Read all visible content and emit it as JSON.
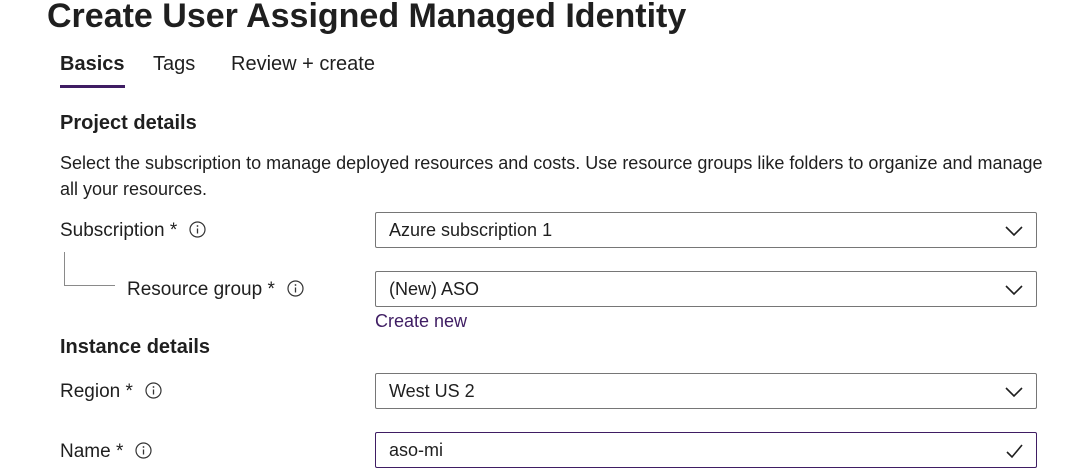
{
  "page": {
    "title": "Create User Assigned Managed Identity"
  },
  "tabs": [
    {
      "label": "Basics",
      "active": true
    },
    {
      "label": "Tags",
      "active": false
    },
    {
      "label": "Review + create",
      "active": false
    }
  ],
  "project_details": {
    "heading": "Project details",
    "description": "Select the subscription to manage deployed resources and costs. Use resource groups like folders to organize and manage all your resources.",
    "subscription": {
      "label": "Subscription *",
      "value": "Azure subscription 1",
      "icon": "chevron-down-icon"
    },
    "resource_group": {
      "label": "Resource group *",
      "value": "(New) ASO",
      "icon": "chevron-down-icon",
      "create_new_label": "Create new"
    }
  },
  "instance_details": {
    "heading": "Instance details",
    "region": {
      "label": "Region *",
      "value": "West US 2",
      "icon": "chevron-down-icon"
    },
    "name": {
      "label": "Name *",
      "value": "aso-mi",
      "icon": "checkmark-icon"
    }
  },
  "colors": {
    "accent": "#3f1d63",
    "text": "#1f1f1f",
    "border": "#767676"
  }
}
